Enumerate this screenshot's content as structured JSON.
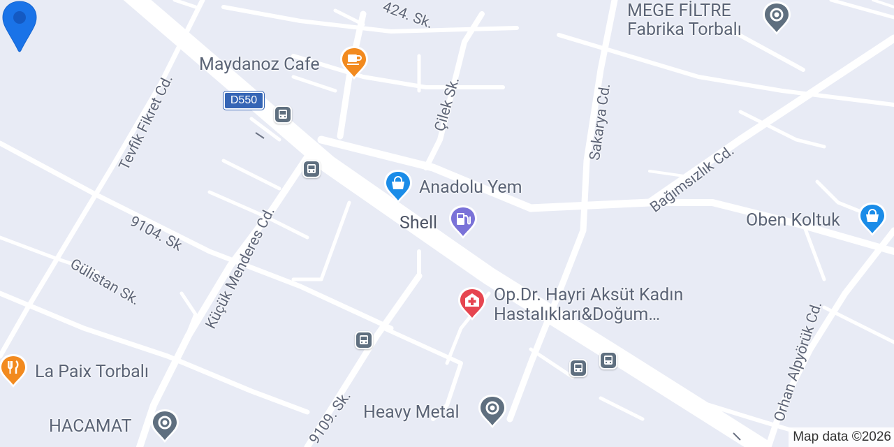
{
  "map": {
    "attribution": "Map data ©2026",
    "route_shield": "D550",
    "streets": {
      "s424": "424. Sk.",
      "cilek": "Çilek Sk.",
      "sakarya": "Sakarya Cd.",
      "bagimsizlik": "Bağımsızlık Cd.",
      "tevfik": "Tevfik Fikret Cd.",
      "kucuk": "Küçük Menderes Cd.",
      "s9104": "9104. Sk",
      "gulistan": "Gülistan Sk.",
      "s9109": "9109. Sk.",
      "orhan": "Orhan Alpyörük Cd."
    },
    "places": {
      "mege_line1": "MEGE FİLTRE",
      "mege_line2": "Fabrika Torbalı",
      "maydanoz": "Maydanoz Cafe",
      "anadolu": "Anadolu Yem",
      "shell": "Shell",
      "oben": "Oben Koltuk",
      "hayri_line1": "Op.Dr. Hayri Aksüt Kadın",
      "hayri_line2": "Hastalıkları&Doğum…",
      "lapaix": "La Paix Torbalı",
      "heavy": "Heavy Metal",
      "hacamat": "HACAMAT"
    },
    "colors": {
      "background": "#e8ebf5",
      "road": "#ffffff",
      "poi_generic": "#5f6f7f",
      "poi_food": "#f28a1f",
      "poi_shop": "#1a8ce8",
      "poi_fuel": "#7a72d8",
      "poi_medical": "#e64550",
      "location_marker": "#1a73e8"
    },
    "icons": {
      "mege": "place-pin-icon",
      "maydanoz": "cafe-cup-icon",
      "anadolu": "shopping-bag-icon",
      "shell": "fuel-pump-icon",
      "oben": "shopping-bag-icon",
      "hayri": "hospital-icon",
      "lapaix": "restaurant-icon",
      "heavy": "place-pin-icon",
      "hacamat": "place-pin-icon",
      "bus": "bus-stop-icon",
      "marker": "location-marker-icon"
    }
  }
}
